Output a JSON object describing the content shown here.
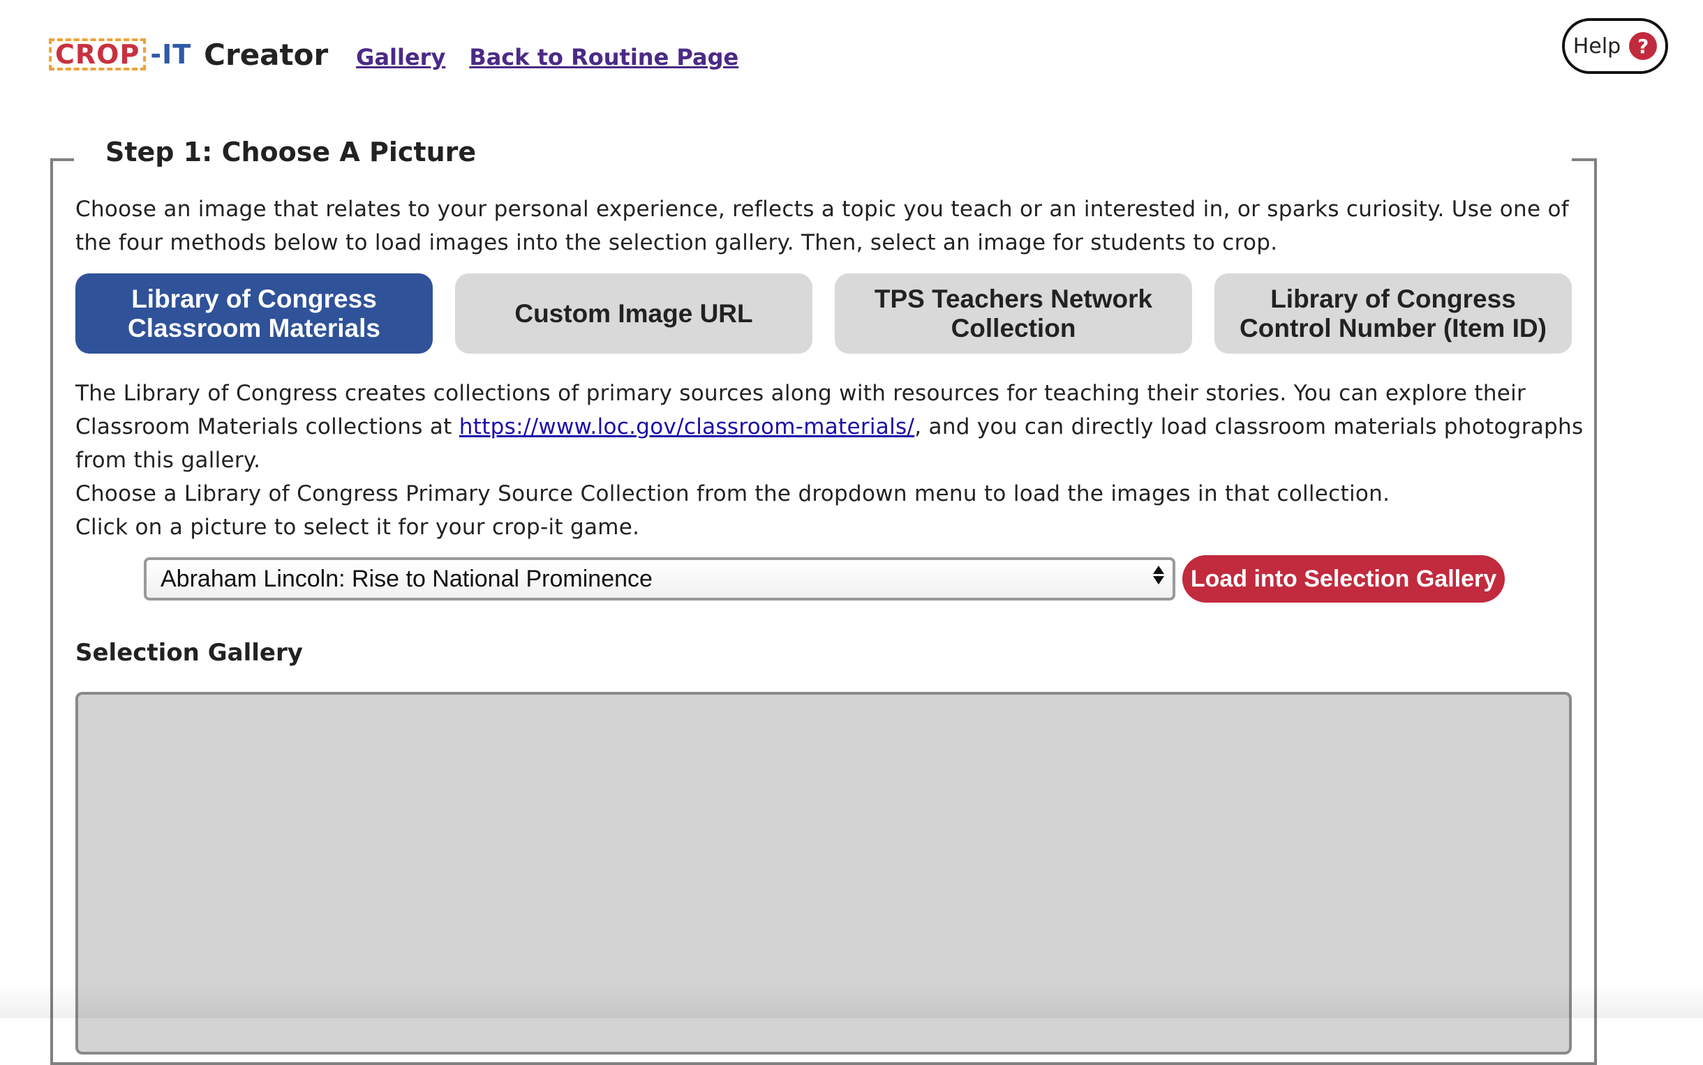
{
  "header": {
    "logo_crop": "CROP",
    "logo_it": "-IT",
    "title": "Creator",
    "links": [
      "Gallery",
      "Back to Routine Page"
    ],
    "help_label": "Help",
    "help_icon_glyph": "?"
  },
  "step1": {
    "title": "Step 1: Choose A Picture",
    "intro": "Choose an image that relates to your personal experience, reflects a topic you teach or an interested in, or sparks curiosity. Use one of the four methods below to load images into the selection gallery. Then, select an image for students to crop.",
    "tabs": [
      {
        "label": "Library of Congress Classroom Materials",
        "active": true
      },
      {
        "label": "Custom Image URL",
        "active": false
      },
      {
        "label": "TPS Teachers Network Collection",
        "active": false
      },
      {
        "label": "Library of Congress Control Number (Item ID)",
        "active": false
      }
    ],
    "description_pre": "The Library of Congress creates collections of primary sources along with resources for teaching their stories. You can explore their Classroom Materials collections at ",
    "description_link": "https://www.loc.gov/classroom-materials/",
    "description_post": ", and you can directly load classroom materials photographs from this gallery.",
    "instruction_line1": "Choose a Library of Congress Primary Source Collection from the dropdown menu to load the images in that collection.",
    "instruction_line2": "Click on a picture to select it for your crop-it game.",
    "collection_select_value": "Abraham Lincoln: Rise to National Prominence",
    "load_button_label": "Load into Selection Gallery",
    "gallery_title": "Selection Gallery"
  },
  "colors": {
    "active_tab": "#2f5299",
    "inactive_tab": "#d9d9d9",
    "load_button": "#c22a3d",
    "link": "#1a0dab",
    "nav_link": "#4b2a85"
  }
}
